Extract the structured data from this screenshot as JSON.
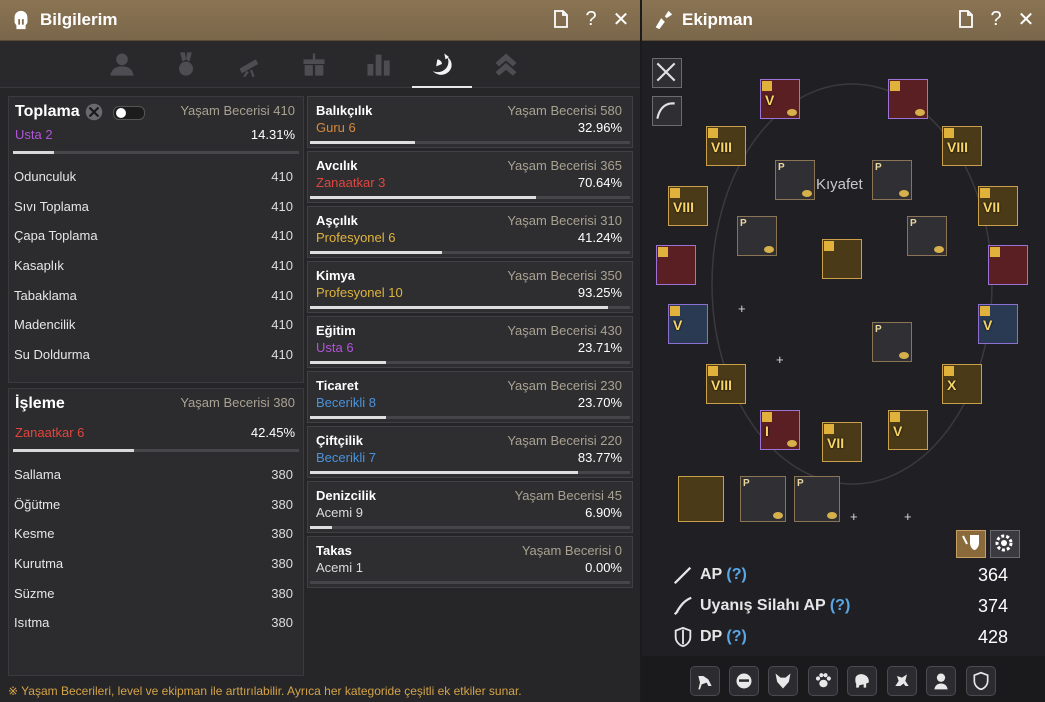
{
  "left_window": {
    "title": "Bilgilerim",
    "ctrl_doc": "🗋",
    "ctrl_help": "?",
    "ctrl_close": "✕",
    "tabs": [
      "profile-icon",
      "medal-icon",
      "telescope-icon",
      "gift-icon",
      "stats-icon",
      "life-skill-icon",
      "rank-icon"
    ],
    "active_tab": 5,
    "gathering": {
      "name": "Toplama",
      "level_label": "Yaşam Becerisi 410",
      "rank": "Usta 2",
      "percent": "14.31%",
      "progress": 0.1431,
      "rank_color": "#b254d8",
      "skills": [
        {
          "name": "Odunculuk",
          "value": "410"
        },
        {
          "name": "Sıvı Toplama",
          "value": "410"
        },
        {
          "name": "Çapa Toplama",
          "value": "410"
        },
        {
          "name": "Kasaplık",
          "value": "410"
        },
        {
          "name": "Tabaklama",
          "value": "410"
        },
        {
          "name": "Madencilik",
          "value": "410"
        },
        {
          "name": "Su Doldurma",
          "value": "410"
        }
      ]
    },
    "processing": {
      "name": "İşleme",
      "level_label": "Yaşam Becerisi 380",
      "rank": "Zanaatkar 6",
      "percent": "42.45%",
      "progress": 0.4245,
      "rank_color": "#e0463e",
      "skills": [
        {
          "name": "Sallama",
          "value": "380"
        },
        {
          "name": "Öğütme",
          "value": "380"
        },
        {
          "name": "Kesme",
          "value": "380"
        },
        {
          "name": "Kurutma",
          "value": "380"
        },
        {
          "name": "Süzme",
          "value": "380"
        },
        {
          "name": "Isıtma",
          "value": "380"
        }
      ]
    },
    "life_skills": [
      {
        "name": "Balıkçılık",
        "level": "Yaşam Becerisi 580",
        "rank": "Guru 6",
        "percent": "32.96%",
        "progress": 0.3296,
        "rank_color": "#d98a3a"
      },
      {
        "name": "Avcılık",
        "level": "Yaşam Becerisi 365",
        "rank": "Zanaatkar 3",
        "percent": "70.64%",
        "progress": 0.7064,
        "rank_color": "#e0463e"
      },
      {
        "name": "Aşçılık",
        "level": "Yaşam Becerisi 310",
        "rank": "Profesyonel 6",
        "percent": "41.24%",
        "progress": 0.4124,
        "rank_color": "#e0b43c"
      },
      {
        "name": "Kimya",
        "level": "Yaşam Becerisi 350",
        "rank": "Profesyonel 10",
        "percent": "93.25%",
        "progress": 0.9325,
        "rank_color": "#e0b43c"
      },
      {
        "name": "Eğitim",
        "level": "Yaşam Becerisi 430",
        "rank": "Usta 6",
        "percent": "23.71%",
        "progress": 0.2371,
        "rank_color": "#b254d8"
      },
      {
        "name": "Ticaret",
        "level": "Yaşam Becerisi 230",
        "rank": "Becerikli 8",
        "percent": "23.70%",
        "progress": 0.237,
        "rank_color": "#4a93da"
      },
      {
        "name": "Çiftçilik",
        "level": "Yaşam Becerisi 220",
        "rank": "Becerikli 7",
        "percent": "83.77%",
        "progress": 0.8377,
        "rank_color": "#4a93da"
      },
      {
        "name": "Denizcilik",
        "level": "Yaşam Becerisi 45",
        "rank": "Acemi 9",
        "percent": "6.90%",
        "progress": 0.069,
        "rank_color": "#dcdcdc"
      },
      {
        "name": "Takas",
        "level": "Yaşam Becerisi 0",
        "rank": "Acemi 1",
        "percent": "0.00%",
        "progress": 0.0,
        "rank_color": "#dcdcdc"
      }
    ],
    "footnote": "※ Yaşam Becerileri, level ve ekipman ile arttırılabilir. Ayrıca her kategoride çeşitli ek etkiler sunar."
  },
  "right_window": {
    "title": "Ekipman",
    "ctrl_doc": "🗋",
    "ctrl_help": "?",
    "ctrl_close": "✕",
    "kiyafet_label": "Kıyafet",
    "slot_marks": {
      "viii": "VIII",
      "vii": "VII",
      "v": "V",
      "x": "X",
      "i": "I",
      "p": "P"
    },
    "stats": [
      {
        "label": "AP",
        "q": "(?)",
        "value": "364"
      },
      {
        "label": "Uyanış Silahı AP",
        "q": "(?)",
        "value": "374"
      },
      {
        "label": "DP",
        "q": "(?)",
        "value": "428"
      }
    ],
    "plus": "+",
    "bottom_icons": [
      "mount-icon",
      "pet-icon",
      "fox-icon",
      "paw-icon",
      "elephant-icon",
      "horse-icon",
      "maid-icon",
      "shield-icon"
    ]
  }
}
